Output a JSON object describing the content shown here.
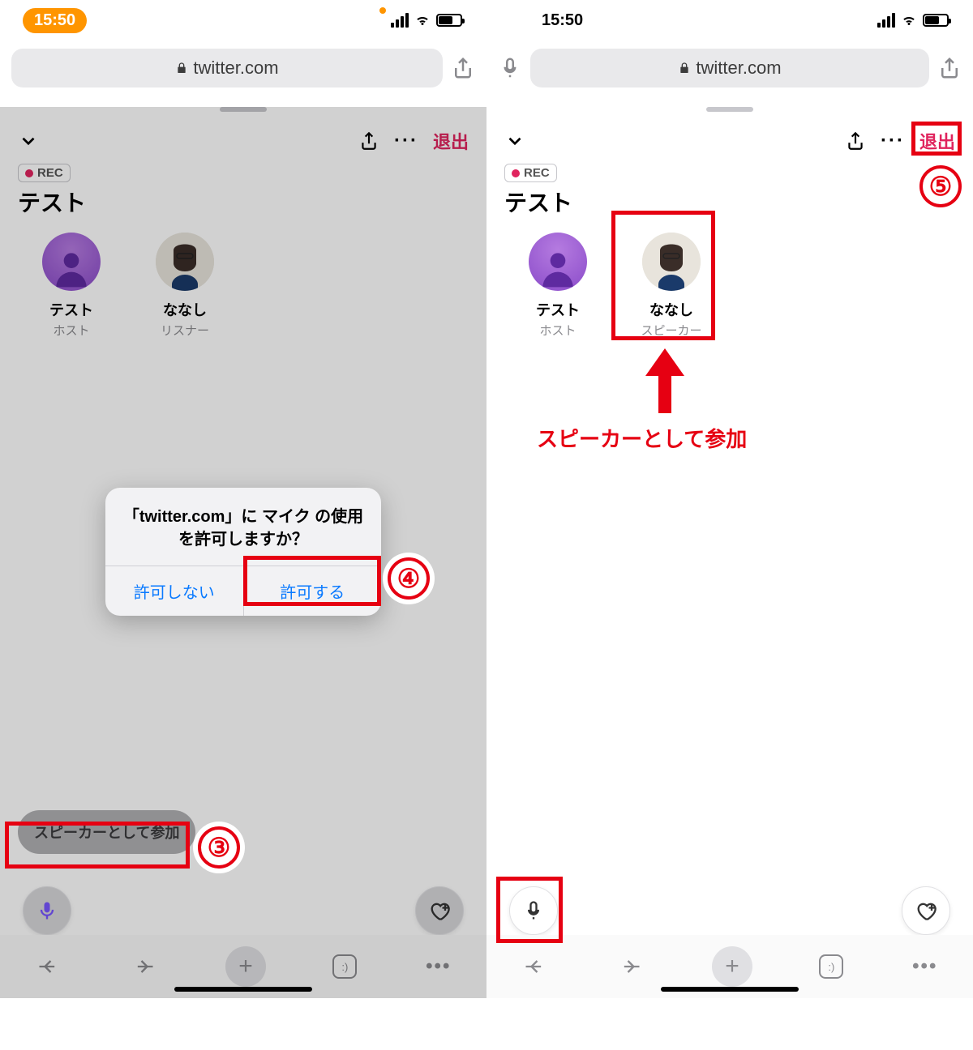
{
  "left": {
    "status": {
      "time": "15:50"
    },
    "url": "twitter.com",
    "topbar": {
      "exit": "退出"
    },
    "rec_label": "REC",
    "space_title": "テスト",
    "participants": [
      {
        "name": "テスト",
        "role": "ホスト",
        "kind": "host"
      },
      {
        "name": "ななし",
        "role": "リスナー",
        "kind": "user"
      }
    ],
    "speaker_join": "スピーカーとして参加",
    "alert": {
      "title": "「twitter.com」に マイク の使用を許可しますか？",
      "deny": "許可しない",
      "allow": "許可する"
    },
    "anno": {
      "n3": "③",
      "n4": "④"
    }
  },
  "right": {
    "status": {
      "time": "15:50"
    },
    "url": "twitter.com",
    "topbar": {
      "exit": "退出"
    },
    "rec_label": "REC",
    "space_title": "テスト",
    "participants": [
      {
        "name": "テスト",
        "role": "ホスト",
        "kind": "host"
      },
      {
        "name": "ななし",
        "role": "スピーカー",
        "kind": "user"
      }
    ],
    "anno": {
      "n5": "⑤",
      "caption": "スピーカーとして参加"
    }
  },
  "safari_nav": {
    "tabs_face": ":)"
  }
}
